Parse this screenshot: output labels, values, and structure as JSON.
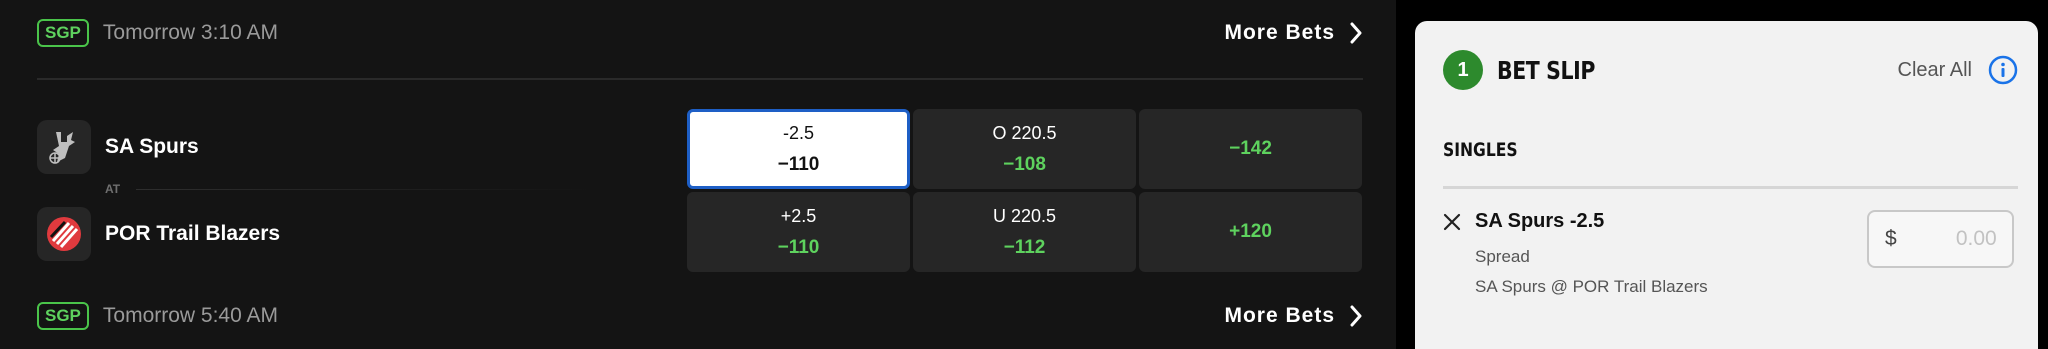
{
  "games": [
    {
      "badge": "SGP",
      "time": "Tomorrow 3:10 AM",
      "more_bets": "More Bets",
      "away_team": "SA Spurs",
      "home_team": "POR Trail Blazers",
      "at_label": "AT",
      "odds": {
        "away": {
          "spread_line": "-2.5",
          "spread_price": "−110",
          "total_line": "O 220.5",
          "total_price": "−108",
          "moneyline": "−142"
        },
        "home": {
          "spread_line": "+2.5",
          "spread_price": "−110",
          "total_line": "U 220.5",
          "total_price": "−112",
          "moneyline": "+120"
        }
      }
    },
    {
      "badge": "SGP",
      "time": "Tomorrow 5:40 AM",
      "more_bets": "More Bets"
    }
  ],
  "bet_slip": {
    "count": "1",
    "title": "BET SLIP",
    "clear_all": "Clear All",
    "section": "SINGLES",
    "pick": {
      "name": "SA Spurs -2.5",
      "odds": "−110",
      "type": "Spread",
      "matchup": "SA Spurs @ POR Trail Blazers",
      "currency": "$",
      "wager_placeholder": "0.00"
    }
  },
  "colors": {
    "accent_green": "#5ed25e",
    "selected_border": "#1e5fc6",
    "info_blue": "#1a73e8"
  },
  "icons": [
    "chevron-right-icon",
    "spurs-logo-icon",
    "trail-blazers-logo-icon",
    "info-icon",
    "close-icon"
  ]
}
